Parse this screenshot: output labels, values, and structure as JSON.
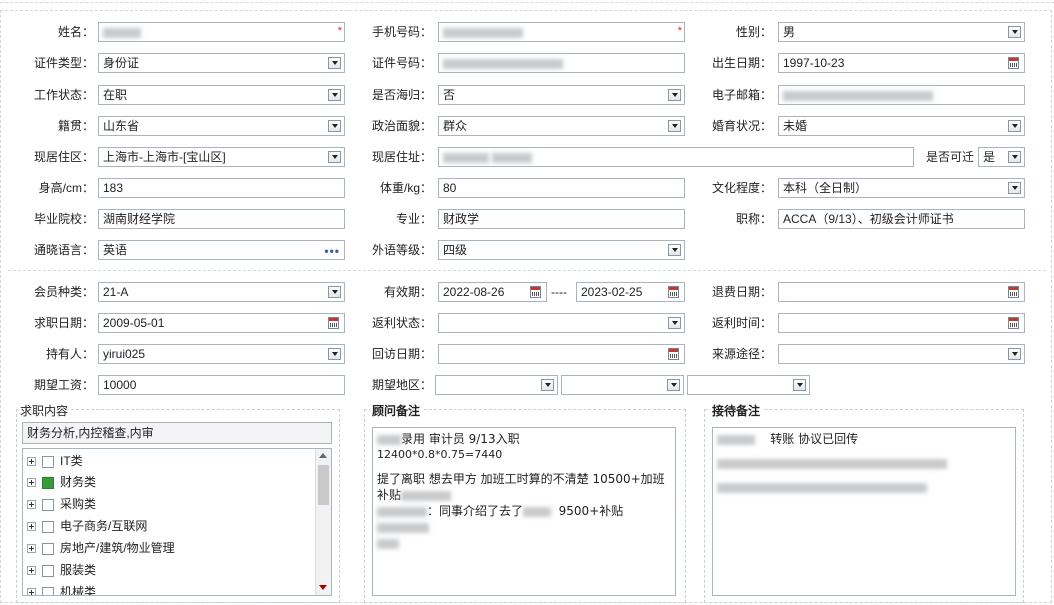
{
  "personal": {
    "name": {
      "label": "姓名："
    },
    "mobile": {
      "label": "手机号码："
    },
    "gender": {
      "label": "性别：",
      "value": "男"
    },
    "id_type": {
      "label": "证件类型：",
      "value": "身份证"
    },
    "id_number": {
      "label": "证件号码："
    },
    "birth_date": {
      "label": "出生日期：",
      "value": "1997-10-23"
    },
    "work_status": {
      "label": "工作状态：",
      "value": "在职"
    },
    "overseas": {
      "label": "是否海归：",
      "value": "否"
    },
    "email": {
      "label": "电子邮箱："
    },
    "native_place": {
      "label": "籍贯：",
      "value": "山东省"
    },
    "political": {
      "label": "政治面貌：",
      "value": "群众"
    },
    "marital": {
      "label": "婚育状况：",
      "value": "未婚"
    },
    "current_area": {
      "label": "现居住区：",
      "value": "上海市-上海市-[宝山区]"
    },
    "current_address": {
      "label": "现居住址："
    },
    "relocate": {
      "label": "是否可迁",
      "value": "是"
    },
    "height": {
      "label": "身高/cm：",
      "value": "183"
    },
    "weight": {
      "label": "体重/kg：",
      "value": "80"
    },
    "education": {
      "label": "文化程度：",
      "value": "本科（全日制）"
    },
    "school": {
      "label": "毕业院校：",
      "value": "湖南财经学院"
    },
    "major": {
      "label": "专业：",
      "value": "财政学"
    },
    "title": {
      "label": "职称：",
      "value": "ACCA（9/13）、初级会计师证书"
    },
    "language": {
      "label": "通晓语言：",
      "value": "英语"
    },
    "lang_level": {
      "label": "外语等级：",
      "value": "四级"
    }
  },
  "membership": {
    "member_type": {
      "label": "会员种类：",
      "value": "21-A"
    },
    "validity": {
      "label": "有效期：",
      "start": "2022-08-26",
      "sep": "----",
      "end": "2023-02-25"
    },
    "refund_date": {
      "label": "退费日期："
    },
    "job_date": {
      "label": "求职日期：",
      "value": "2009-05-01"
    },
    "rebate_status": {
      "label": "返利状态："
    },
    "rebate_time": {
      "label": "返利时间："
    },
    "holder": {
      "label": "持有人：",
      "value": "yirui025"
    },
    "visit_date": {
      "label": "回访日期："
    },
    "source": {
      "label": "来源途径："
    },
    "salary": {
      "label": "期望工资：",
      "value": "10000"
    },
    "region": {
      "label": "期望地区："
    }
  },
  "job_content": {
    "title": "求职内容",
    "summary": "财务分析,内控稽查,内审",
    "items": [
      {
        "label": "IT类",
        "checked": false
      },
      {
        "label": "财务类",
        "checked": true
      },
      {
        "label": "采购类",
        "checked": false
      },
      {
        "label": "电子商务/互联网",
        "checked": false
      },
      {
        "label": "房地产/建筑/物业管理",
        "checked": false
      },
      {
        "label": "服装类",
        "checked": false
      },
      {
        "label": "机械类",
        "checked": false
      }
    ]
  },
  "consultant_notes": {
    "title": "顾问备注",
    "line1": "录用  审计员  9/13入职",
    "line2": "12400*0.8*0.75=7440",
    "line3": "提了离职  想去甲方 加班工时算的不清楚  10500+加班",
    "line4": "补贴",
    "line5": "：同事介绍了去了",
    "line5b": "9500+补贴"
  },
  "reception_notes": {
    "title": "接待备注",
    "line1": "转账  协议已回传"
  }
}
